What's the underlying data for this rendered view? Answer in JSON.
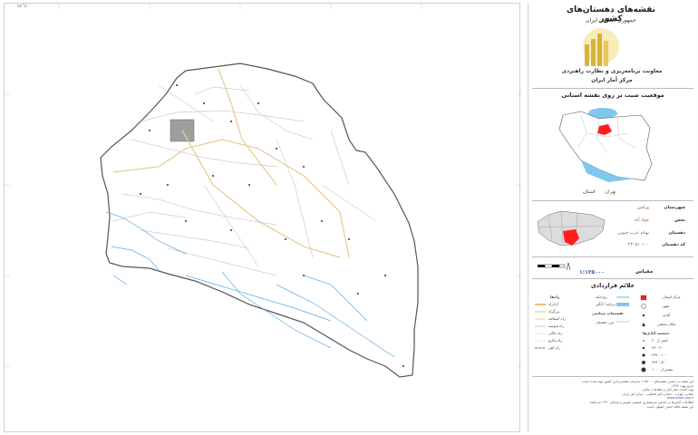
{
  "map": {
    "top_label": "۵۸°۵۰'"
  },
  "panel": {
    "title": "نقشه‌های دهستان‌های کشور",
    "subtitle": "جمهوری اسلامی ایران",
    "org_line1": "معاونت برنامه‌ریزی و نظارت راهبردی",
    "org_line2": "مرکز آمار ایران",
    "location_heading": "موقعیت شیت بر روی نقشه استانی",
    "province_label": "استان",
    "province_value": "تهران",
    "rows": [
      {
        "label": "شهرستان",
        "value": "ورامین"
      },
      {
        "label": "بخش",
        "value": "جواد آباد"
      },
      {
        "label": "دهستان",
        "value": "بهنام عرب جنوبی"
      },
      {
        "label": "کد دهستان",
        "value": "۲۳۰۵۱۰۱۰۰"
      }
    ],
    "scale_label": "مقیاس",
    "scale_value": "۱:۱۲۵۰۰۰",
    "legend_heading": "علائم قراردادی",
    "legend_left_heading": "راه‌ها",
    "legend_left_items": [
      "آزادراه",
      "بزرگراه",
      "راه آسفالته",
      "راه شوسه",
      "راه خاکی",
      "راه مالرو",
      "راه آهن"
    ],
    "legend_center_items": [
      "رودخانه",
      "دریاچه / آبگیر",
      "مرز دهستان"
    ],
    "legend_center_heading": "تقسیمات سیاسی",
    "legend_right_items": [
      "مرکز استان",
      "شهر",
      "آبادی",
      "مکان مذهبی"
    ],
    "legend_right_heading": "جمعیت آبادی‌ها",
    "legend_right_pop": [
      "کمتر از ۲۰",
      "۲۰ - ۹۹",
      "۱۰۰ - ۴۹۹",
      "۵۰۰ - ۹۹۹",
      "بیشتر از ۱۰۰۰"
    ],
    "footer_lines": [
      "این نقشه بر اساس نقشه‌های ۱:۲۵۰۰۰ سازمان نقشه‌برداری کشور تهیه شده است.",
      "تاریخ تهیه: ۱۳۹۴",
      "تهیه کننده: دفتر آمار و اطلاعات مکانی",
      "نشانی: تهران - خیابان دکتر فاطمی - مرکز آمار ایران",
      "www.amar.org.ir",
      "اطلاعات آبادی‌ها بر اساس سرشماری عمومی نفوس و مسکن ۱۳۹۰ می‌باشد.",
      "این نقشه فاقد اعتبار حقوقی است."
    ],
    "colors": {
      "district_fill": "#ffffff",
      "district_stroke": "#555555",
      "river": "#4aa3df",
      "road_main": "#e8d29a",
      "road_minor": "#9a9a9a",
      "highlight": "#ff1f1f",
      "iran_sea": "#7ec8ef"
    }
  }
}
